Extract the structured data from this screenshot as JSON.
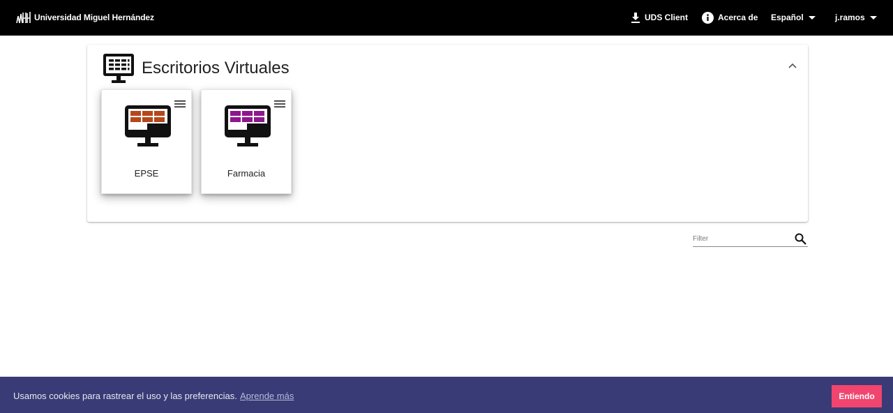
{
  "header": {
    "brand": "Universidad Miguel Hernández",
    "uds_client": "UDS Client",
    "about": "Acerca de",
    "language": "Español",
    "user": "j.ramos"
  },
  "panel": {
    "title": "Escritorios Virtuales",
    "tiles": [
      {
        "label": "EPSE",
        "badge": "umh",
        "screen_color": "#b5471b"
      },
      {
        "label": "Farmacia",
        "badge": "umh",
        "screen_color": "#8e178e"
      }
    ]
  },
  "filter": {
    "placeholder": "Filter",
    "value": ""
  },
  "cookie": {
    "text": "Usamos cookies para rastrear el uso y las preferencias.",
    "link": "Aprende más",
    "button": "Entiendo"
  },
  "colors": {
    "topbar": "#000000",
    "cookie_bar": "#383b75",
    "cookie_button": "#f1456f"
  }
}
